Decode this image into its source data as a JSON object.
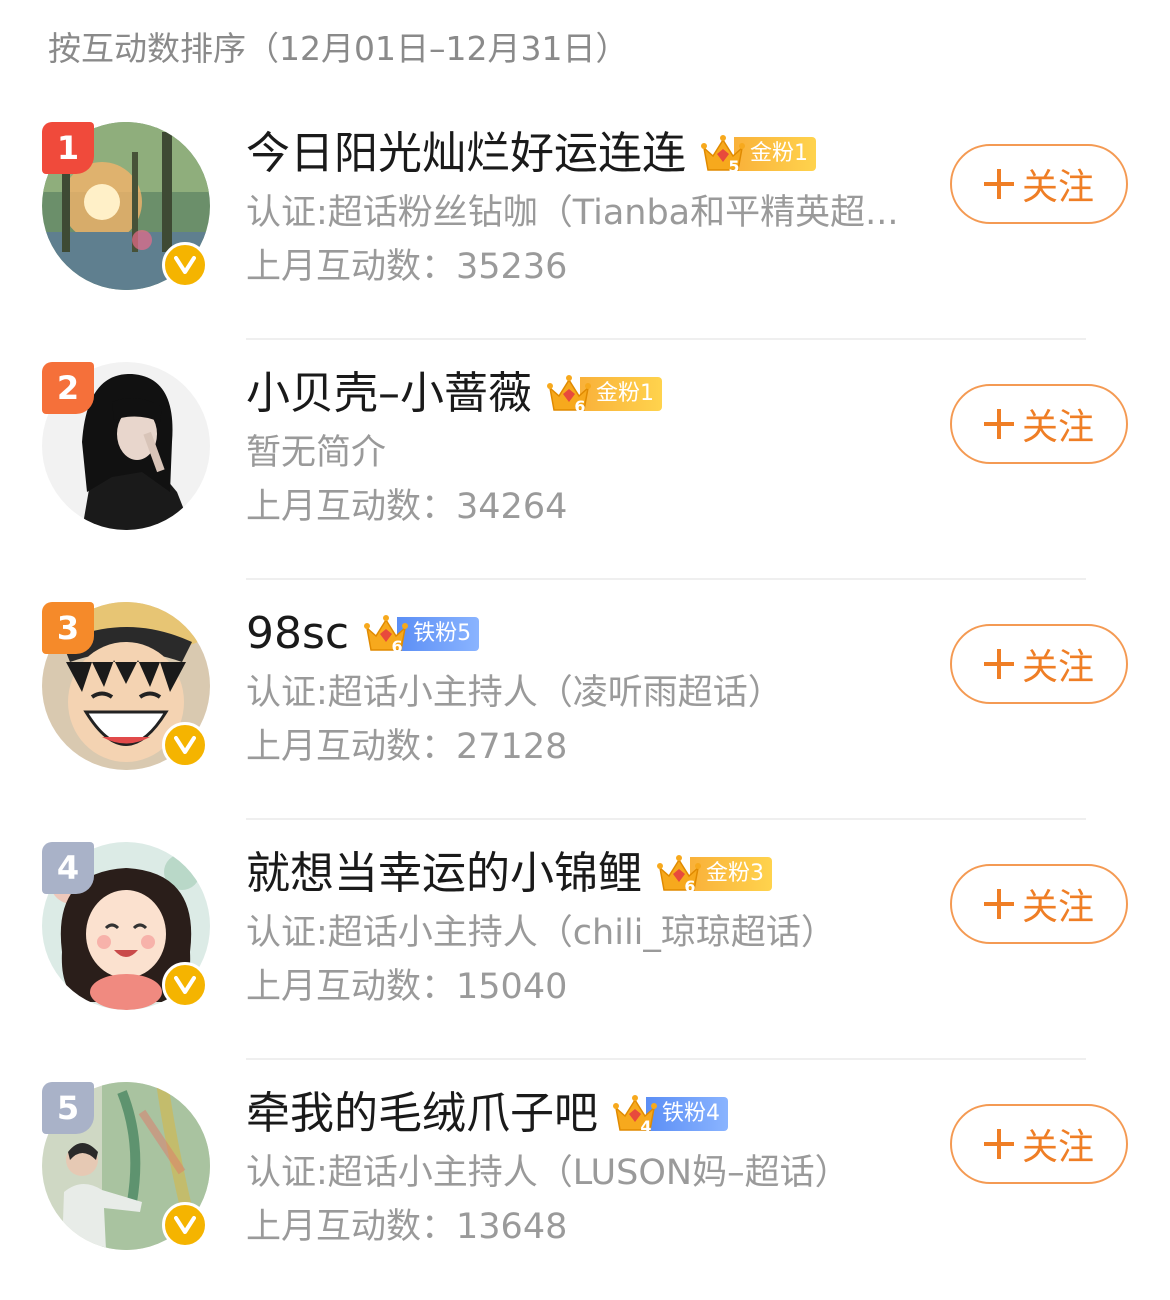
{
  "header": "按互动数排序（12月01日–12月31日）",
  "follow_label": "关注",
  "count_prefix": "上月互动数：",
  "colors": {
    "rank1": "#f04a3b",
    "rank2": "#f5703a",
    "rank3": "#f58a2a",
    "rank_other": "#a9b2c8",
    "verified": "#f5b400",
    "follow": "#ef7e25"
  },
  "users": [
    {
      "rank": "1",
      "name": "今日阳光灿烂好运连连",
      "fan_level": "5",
      "fan_label": "金粉1",
      "fan_type": "gold",
      "desc": "认证:超话粉丝钻咖（Tianba和平精英超...",
      "count": "35236",
      "verified": true,
      "avatar": "sunset-park-photo"
    },
    {
      "rank": "2",
      "name": "小贝壳–小蔷薇",
      "fan_level": "6",
      "fan_label": "金粉1",
      "fan_type": "gold",
      "desc": "暂无简介",
      "count": "34264",
      "verified": false,
      "avatar": "woman-black-hair-photo"
    },
    {
      "rank": "3",
      "name": "98sc",
      "fan_level": "6",
      "fan_label": "铁粉5",
      "fan_type": "iron",
      "desc": "认证:超话小主持人（凌听雨超话）",
      "count": "27128",
      "verified": true,
      "avatar": "anime-straw-hat-boy"
    },
    {
      "rank": "4",
      "name": "就想当幸运的小锦鲤",
      "fan_level": "6",
      "fan_label": "金粉3",
      "fan_type": "gold",
      "desc": "认证:超话小主持人（chili_琼琼超话）",
      "count": "15040",
      "verified": true,
      "avatar": "cartoon-curly-girl"
    },
    {
      "rank": "5",
      "name": "牵我的毛绒爪子吧",
      "fan_level": "4",
      "fan_label": "铁粉4",
      "fan_type": "iron",
      "desc": "认证:超话小主持人（LUSON妈–超话）",
      "count": "13648",
      "verified": true,
      "avatar": "man-painted-wall-photo"
    }
  ]
}
